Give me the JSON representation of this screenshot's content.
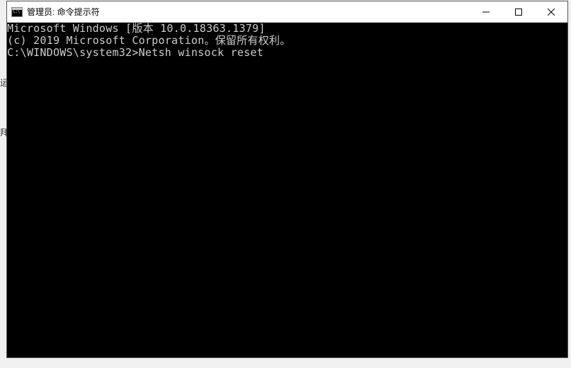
{
  "window": {
    "title": "管理员: 命令提示符",
    "icon_label": "cmd-icon"
  },
  "terminal": {
    "line1": "Microsoft Windows [版本 10.0.18363.1379]",
    "line2": "(c) 2019 Microsoft Corporation。保留所有权利。",
    "blank": "",
    "prompt": "C:\\WINDOWS\\system32>",
    "command": "Netsh winsock reset"
  },
  "controls": {
    "minimize": "minimize",
    "maximize": "maximize",
    "close": "close"
  },
  "artifacts": {
    "left1": "运",
    "left2": "拜",
    "bottom": ""
  }
}
